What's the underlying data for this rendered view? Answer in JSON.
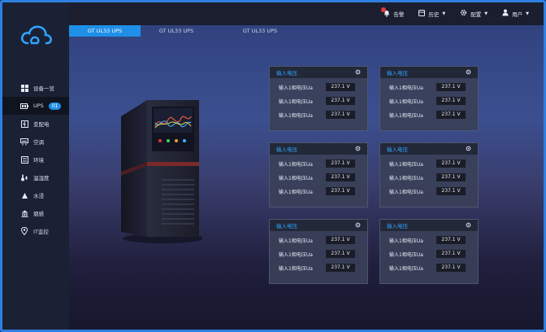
{
  "topbar": {
    "alarm_label": "告警",
    "history_label": "历史",
    "config_label": "配置",
    "user_label": "用户"
  },
  "sidebar": {
    "items": [
      {
        "label": "设备一览",
        "icon": "grid-icon"
      },
      {
        "label": "UPS",
        "icon": "battery-icon",
        "badge": "01"
      },
      {
        "label": "变配电",
        "icon": "power-icon"
      },
      {
        "label": "空调",
        "icon": "aircon-icon"
      },
      {
        "label": "环境",
        "icon": "environment-icon"
      },
      {
        "label": "温湿度",
        "icon": "thermometer-icon"
      },
      {
        "label": "水浸",
        "icon": "water-icon"
      },
      {
        "label": "烟感",
        "icon": "smoke-icon"
      },
      {
        "label": "IT监控",
        "icon": "location-icon"
      }
    ]
  },
  "tabs": [
    {
      "label": "GT UL33 UPS"
    },
    {
      "label": "GT UL33 UPS"
    },
    {
      "label": "GT UL33 UPS"
    }
  ],
  "panels": [
    {
      "title": "输入电压",
      "rows": [
        {
          "label": "输入1相电压Ua",
          "value": "237.1 V"
        },
        {
          "label": "输入1相电压Ua",
          "value": "237.1 V"
        },
        {
          "label": "输入1相电压Ua",
          "value": "237.1 V"
        }
      ]
    },
    {
      "title": "输入电压",
      "rows": [
        {
          "label": "输入1相电压Ua",
          "value": "237.1 V"
        },
        {
          "label": "输入1相电压Ua",
          "value": "237.1 V"
        },
        {
          "label": "输入1相电压Ua",
          "value": "237.1 V"
        }
      ]
    },
    {
      "title": "输入电压",
      "rows": [
        {
          "label": "输入1相电压Ua",
          "value": "237.1 V"
        },
        {
          "label": "输入1相电压Ua",
          "value": "237.1 V"
        },
        {
          "label": "输入1相电压Ua",
          "value": "237.1 V"
        }
      ]
    },
    {
      "title": "输入电压",
      "rows": [
        {
          "label": "输入1相电压Ua",
          "value": "237.1 V"
        },
        {
          "label": "输入1相电压Ua",
          "value": "237.1 V"
        },
        {
          "label": "输入1相电压Ua",
          "value": "237.1 V"
        }
      ]
    },
    {
      "title": "输入电压",
      "rows": [
        {
          "label": "输入1相电压Ua",
          "value": "237.1 V"
        },
        {
          "label": "输入1相电压Ua",
          "value": "237.1 V"
        },
        {
          "label": "输入1相电压Ua",
          "value": "237.1 V"
        }
      ]
    },
    {
      "title": "输入电压",
      "rows": [
        {
          "label": "输入1相电压Ua",
          "value": "237.1 V"
        },
        {
          "label": "输入1相电压Ua",
          "value": "237.1 V"
        },
        {
          "label": "输入1相电压Ua",
          "value": "237.1 V"
        }
      ]
    }
  ],
  "colors": {
    "accent": "#1f8fe8",
    "frame": "#2f7fe0",
    "title": "#2fa4ff",
    "alarm": "#e53a3a"
  }
}
